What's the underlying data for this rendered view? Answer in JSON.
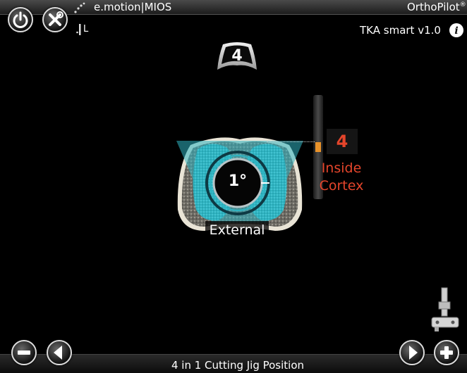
{
  "header": {
    "app_name": "e.motion|MIOS",
    "brand": "OrthoPilot",
    "brand_mark": "®",
    "version": "TKA smart v1.0",
    "side": "L"
  },
  "badge": {
    "value": "4"
  },
  "rotation": {
    "value": "1°",
    "direction_label": "External"
  },
  "depth": {
    "value": "4",
    "label_line1": "Inside",
    "label_line2": "Cortex",
    "color": "#e5452b"
  },
  "colors": {
    "teal": "#2fb4c2",
    "accent_orange": "#e8922a"
  },
  "icons": [
    "power-icon",
    "tools-icon",
    "info-icon",
    "minus-icon",
    "left-arrow-icon",
    "right-arrow-icon",
    "plus-icon",
    "cutting-jig-icon"
  ],
  "footer": {
    "step_title": "4 in 1 Cutting Jig Position"
  }
}
